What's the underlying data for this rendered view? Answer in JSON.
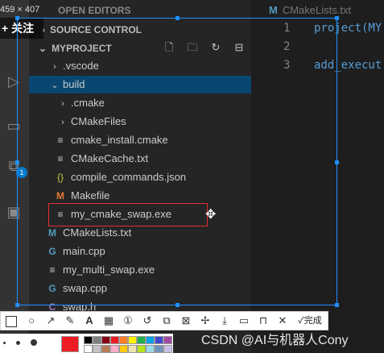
{
  "overlay": {
    "dimension_label": "459 × 407",
    "follow_label": "+ 关注",
    "watermark": "CSDN @AI与机器人Cony"
  },
  "activity": {
    "badge": "1"
  },
  "explorer": {
    "open_editors": "OPEN EDITORS",
    "source_control": "SOURCE CONTROL",
    "project": "MYPROJECT",
    "items": [
      {
        "label": ".vscode",
        "kind": "folder-closed"
      },
      {
        "label": "build",
        "kind": "folder-open"
      },
      {
        "label": ".cmake",
        "kind": "folder-closed"
      },
      {
        "label": "CMakeFiles",
        "kind": "folder-closed"
      },
      {
        "label": "cmake_install.cmake",
        "kind": "text"
      },
      {
        "label": "CMakeCache.txt",
        "kind": "text"
      },
      {
        "label": "compile_commands.json",
        "kind": "json"
      },
      {
        "label": "Makefile",
        "kind": "makefile"
      },
      {
        "label": "my_cmake_swap.exe",
        "kind": "text"
      },
      {
        "label": "CMakeLists.txt",
        "kind": "cmake"
      },
      {
        "label": "main.cpp",
        "kind": "cpp"
      },
      {
        "label": "my_multi_swap.exe",
        "kind": "text"
      },
      {
        "label": "swap.cpp",
        "kind": "cpp"
      },
      {
        "label": "swap.h",
        "kind": "cpp"
      }
    ]
  },
  "editor": {
    "tab": "CMakeLists.txt",
    "lines": [
      {
        "num": "1",
        "code": "project(MY"
      },
      {
        "num": "2",
        "code": ""
      },
      {
        "num": "3",
        "code": "add_execut"
      }
    ]
  },
  "screenshot_toolbar": {
    "done_label": "完成"
  },
  "colors": {
    "selected_row": "#094771",
    "selection_frame": "#1f8fff",
    "highlight_box": "#e03030",
    "swatches": [
      "#000000",
      "#7f7f7f",
      "#880015",
      "#ed1c24",
      "#ff7f27",
      "#fff200",
      "#22b14c",
      "#00a2e8",
      "#3f48cc",
      "#a349a4",
      "#ffffff",
      "#c3c3c3",
      "#b97a57",
      "#ffaec9",
      "#ffc90e",
      "#efe4b0",
      "#b5e61d",
      "#99d9ea",
      "#7092be",
      "#c8bfe7"
    ]
  }
}
